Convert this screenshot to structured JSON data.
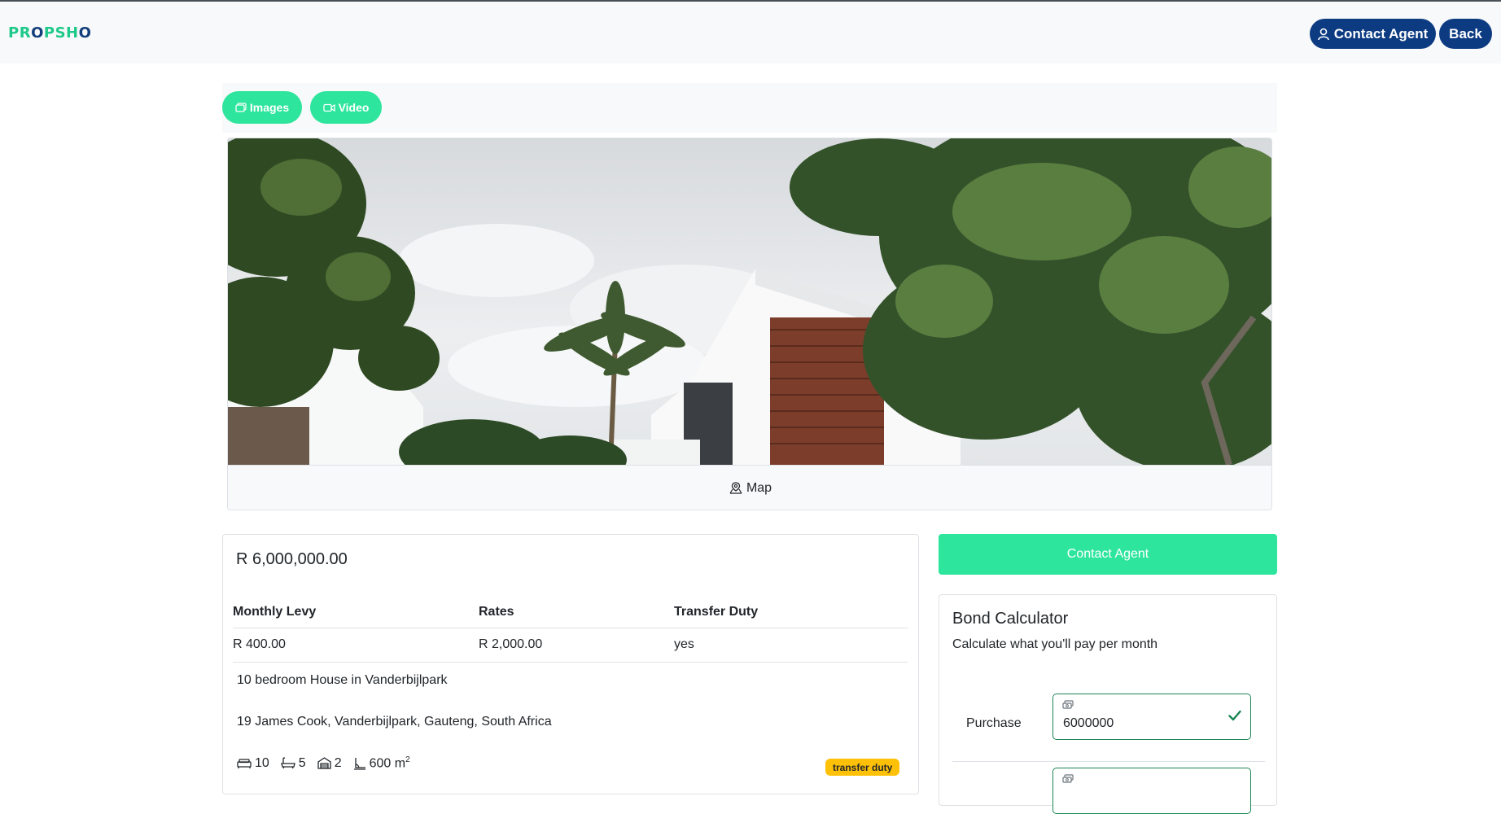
{
  "brand": {
    "logo_part1": "PR",
    "logo_o": "O",
    "logo_part2": "PSH",
    "logo_o2": "O",
    "brand_green": "#2ee59d",
    "brand_navy": "#0d3b82"
  },
  "navbar": {
    "contact_label": "Contact Agent",
    "back_label": "Back"
  },
  "media_tabs": {
    "images_label": "Images",
    "video_label": "Video"
  },
  "hero": {
    "map_label": "Map"
  },
  "listing": {
    "price": "R 6,000,000.00",
    "costs_headers": [
      "Monthly Levy",
      "Rates",
      "Transfer Duty"
    ],
    "costs_values": [
      "R 400.00",
      "R 2,000.00",
      "yes"
    ],
    "title": "10 bedroom House in Vanderbijlpark",
    "address": "19 James Cook, Vanderbijlpark, Gauteng, South Africa",
    "features": {
      "bedrooms": "10",
      "bathrooms": "5",
      "garages": "2",
      "size": "600 m",
      "size_unit_sup": "2"
    },
    "badge": "transfer duty",
    "badge_color": "#ffc107"
  },
  "sidebar": {
    "cta_label": "Contact Agent",
    "calculator": {
      "title": "Bond Calculator",
      "subtitle": "Calculate what you'll pay per month",
      "purchase_label": "Purchase",
      "purchase_value": "6000000"
    }
  }
}
